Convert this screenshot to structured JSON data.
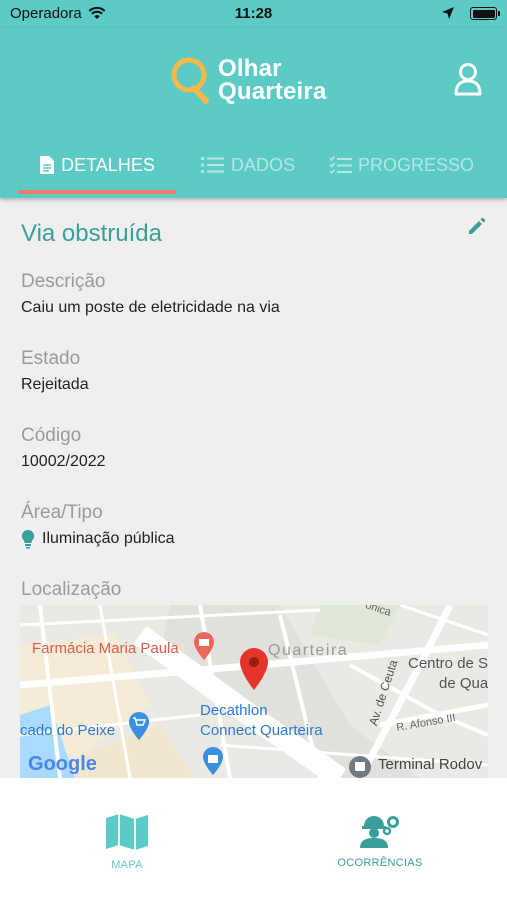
{
  "status_bar": {
    "carrier": "Operadora",
    "time": "11:28"
  },
  "header": {
    "logo_line1": "Olhar",
    "logo_line2": "Quarteira"
  },
  "tabs": [
    {
      "label": "DETALHES",
      "active": true
    },
    {
      "label": "DADOS",
      "active": false
    },
    {
      "label": "PROGRESSO",
      "active": false
    }
  ],
  "detail": {
    "title": "Via obstruída",
    "description_label": "Descrição",
    "description_value": "Caiu um poste de eletricidade na via",
    "state_label": "Estado",
    "state_value": "Rejeitada",
    "code_label": "Código",
    "code_value": "10002/2022",
    "area_label": "Área/Tipo",
    "area_value": "Iluminação pública",
    "location_label": "Localização"
  },
  "map": {
    "places": {
      "pharmacy": "Farmácia Maria Paula",
      "town": "Quarteira",
      "center_1": "Centro de S",
      "center_2": "de Qua",
      "market": "cado do Peixe",
      "decathlon_1": "Decathlon",
      "decathlon_2": "Connect Quarteira",
      "terminal": "Terminal Rodov",
      "av_ceuta": "Av. de Ceuta",
      "r_afonso": "R. Afonso III",
      "street_top": "ônica"
    },
    "attribution": "Google"
  },
  "bottom_nav": {
    "map_label": "MAPA",
    "occurrences_label": "OCORRÊNCIAS"
  },
  "colors": {
    "primary": "#5ccbc5",
    "primary_dark": "#3a9e9a",
    "indicator": "#f47b6b",
    "logo_accent": "#f6b94a"
  }
}
